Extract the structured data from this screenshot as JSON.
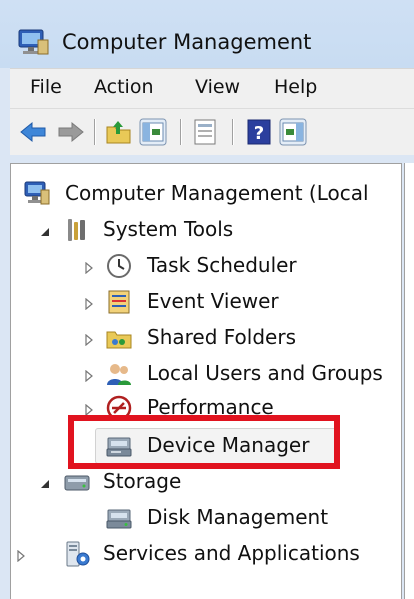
{
  "window": {
    "title": "Computer Management"
  },
  "menu": {
    "items": [
      "File",
      "Action",
      "View",
      "Help"
    ]
  },
  "toolbar": {
    "buttons": [
      "back-icon",
      "forward-icon",
      "up-folder-icon",
      "show-hide-tree-icon",
      "properties-icon",
      "help-icon",
      "show-hide-action-pane-icon"
    ]
  },
  "tree": {
    "root": "Computer Management (Local",
    "system_tools": "System Tools",
    "task_scheduler": "Task Scheduler",
    "event_viewer": "Event Viewer",
    "shared_folders": "Shared Folders",
    "local_users": "Local Users and Groups",
    "performance": "Performance",
    "device_manager": "Device Manager",
    "storage": "Storage",
    "disk_management": "Disk Management",
    "services": "Services and Applications"
  },
  "selected_item": "Device Manager",
  "highlight_color": "#e1131f"
}
